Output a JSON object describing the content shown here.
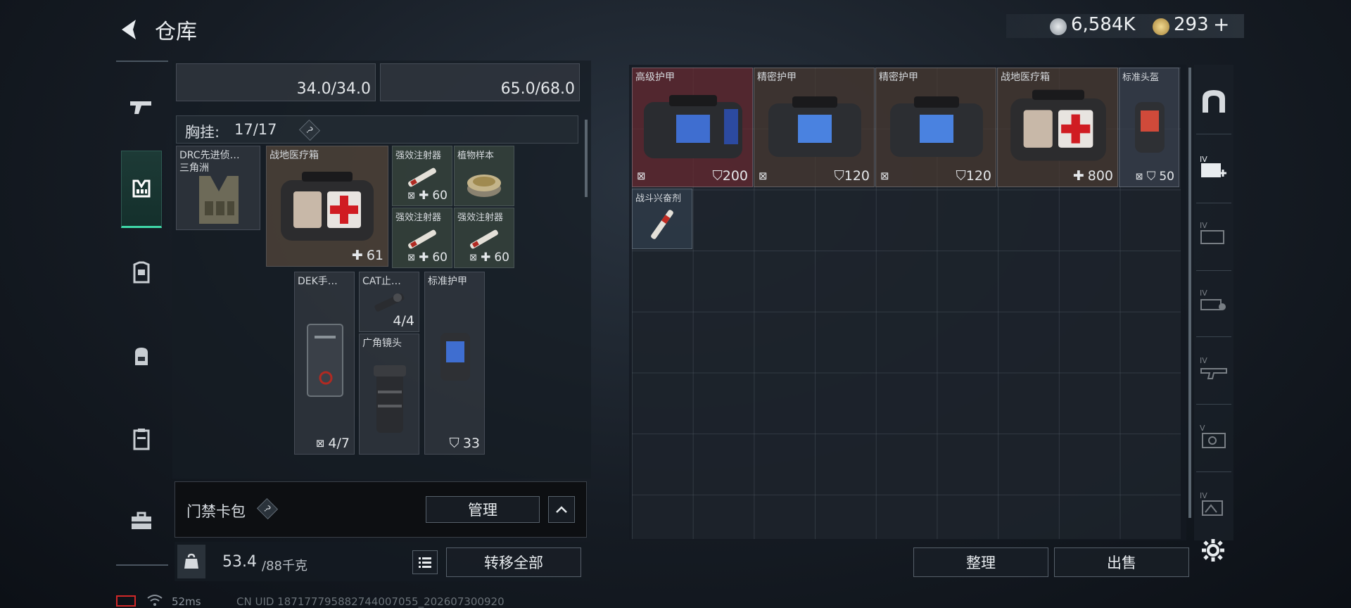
{
  "header": {
    "title": "仓库",
    "currency_primary": "6,584K",
    "currency_secondary": "293",
    "plus": "+"
  },
  "left_nav": {
    "items": [
      "weapon-icon",
      "vest-icon",
      "armor-icon",
      "backpack-icon",
      "container-icon",
      "toolbox-icon"
    ],
    "active": "vest-icon"
  },
  "gear_top": {
    "left_value": "34.0/34.0",
    "right_value": "65.0/68.0"
  },
  "rig": {
    "label": "胸挂:",
    "capacity": "17/17",
    "help": "?",
    "items": [
      {
        "name": "DRC先进侦…",
        "sub": "三角洲"
      },
      {
        "name": "战地医疗箱",
        "value": "61"
      },
      {
        "name": "强效注射器",
        "value": "60"
      },
      {
        "name": "植物样本"
      },
      {
        "name": "强效注射器",
        "value": "60"
      },
      {
        "name": "强效注射器",
        "value": "60"
      },
      {
        "name": "DEK手…",
        "value": "4/7"
      },
      {
        "name": "CAT止…",
        "value": "4/4"
      },
      {
        "name": "广角镜头"
      },
      {
        "name": "标准护甲",
        "value": "33"
      }
    ]
  },
  "keycard": {
    "label": "门禁卡包",
    "help": "?",
    "manage": "管理"
  },
  "footer_left": {
    "weight_value": "53.4",
    "weight_max": "/88千克",
    "transfer": "转移全部"
  },
  "stash": {
    "items": [
      {
        "name": "高级护甲",
        "value": "200"
      },
      {
        "name": "精密护甲",
        "value": "120"
      },
      {
        "name": "精密护甲",
        "value": "120"
      },
      {
        "name": "战地医疗箱",
        "value": "800"
      },
      {
        "name": "标准头盔",
        "value": "50"
      },
      {
        "name": "战斗兴奋剂"
      }
    ],
    "sort_button": "整理",
    "sell_button": "出售"
  },
  "status": {
    "ping": "52ms",
    "uid": "CN UID 18717779588274400705​5_202607300920"
  },
  "colors": {
    "accent": "#3fd8a8",
    "rare_red": "#6a2a30",
    "item_brown": "#4a3a32",
    "item_blue": "#3a4250"
  }
}
